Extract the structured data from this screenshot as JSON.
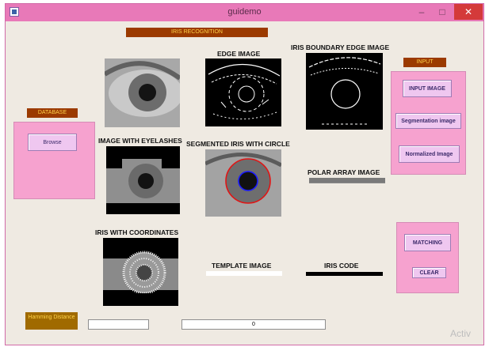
{
  "window": {
    "title": "guidemo",
    "minimize_glyph": "–",
    "maximize_glyph": "□",
    "close_glyph": "✕"
  },
  "banners": {
    "title": "IRIS RECOGNITION",
    "database": "DATABASE",
    "input": "INPUT",
    "hamming": "Hamming Distance"
  },
  "database_panel": {
    "browse_label": "Browse"
  },
  "input_panel": {
    "input_image_label": "INPUT IMAGE",
    "segmentation_label": "Segmentation image",
    "normalized_label": "Normalized Image"
  },
  "match_panel": {
    "matching_label": "MATCHING",
    "clear_label": "CLEAR"
  },
  "captions": {
    "edge": "EDGE IMAGE",
    "boundary": "IRIS BOUNDARY EDGE IMAGE",
    "eyelashes": "IMAGE WITH EYELASHES",
    "segmented": "SEGMENTED IRIS WITH CIRCLE",
    "polar": "POLAR ARRAY IMAGE",
    "coordinates": "IRIS WITH COORDINATES",
    "template": "TEMPLATE IMAGE",
    "iris_code": "IRIS CODE"
  },
  "fields": {
    "hamming_value": "",
    "result_value": "0"
  },
  "watermark": "Activ",
  "icons": {
    "app": "matlab-figure-icon"
  },
  "colors": {
    "titlebar": "#e879b8",
    "banner": "#9b3a00",
    "banner_text": "#ffd24a",
    "panel": "#f6a2cf",
    "button": "#efc7f0",
    "close": "#d43a3a"
  }
}
